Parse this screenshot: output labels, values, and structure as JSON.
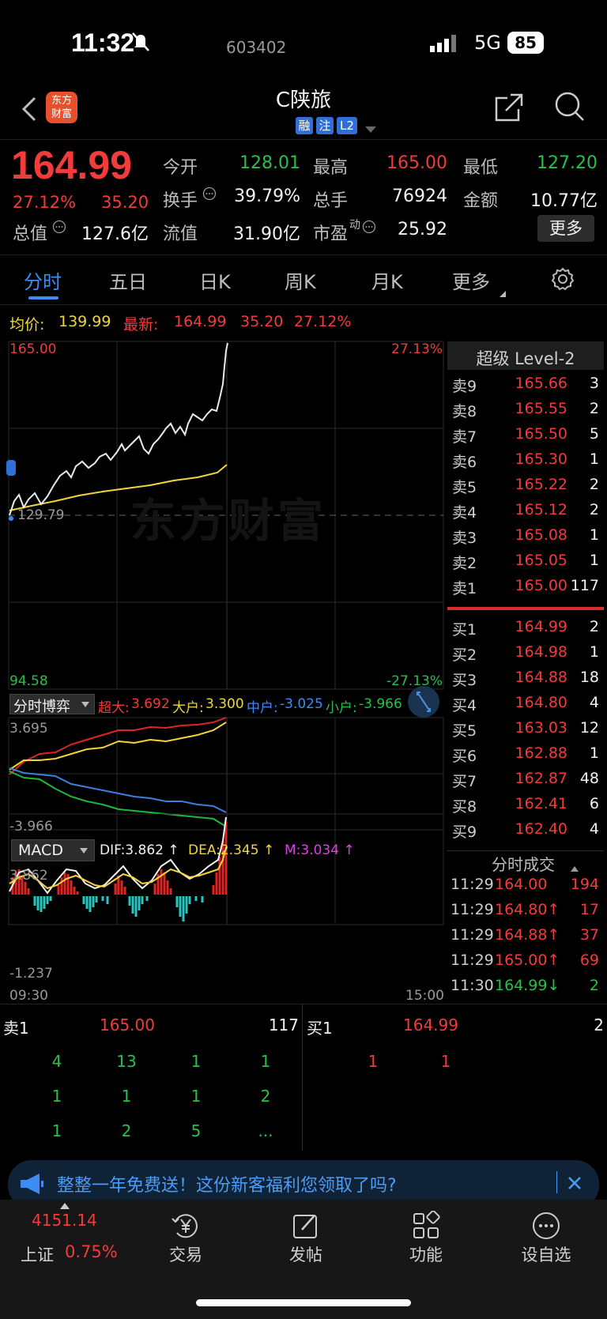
{
  "status_bar": {
    "time": "11:32",
    "network": "5G",
    "battery": "85"
  },
  "header": {
    "logo_line1": "东方",
    "logo_line2": "财富",
    "stock_name": "C陕旅",
    "stock_code": "603402",
    "tags": [
      "融",
      "注",
      "L2"
    ]
  },
  "quote": {
    "price": "164.99",
    "change_pct": "27.12%",
    "change": "35.20",
    "open_label": "今开",
    "open": "128.01",
    "high_label": "最高",
    "high": "165.00",
    "low_label": "最低",
    "low": "127.20",
    "turnover_label": "换手",
    "turnover": "39.79%",
    "volume_label": "总手",
    "volume": "76924",
    "amount_label": "金额",
    "amount": "10.77亿",
    "mktcap_label": "总值",
    "mktcap": "127.6亿",
    "float_label": "流值",
    "float_cap": "31.90亿",
    "pe_label": "市盈",
    "pe_sup": "动",
    "pe": "25.92",
    "more_button": "更多"
  },
  "tabs": [
    "分时",
    "五日",
    "日K",
    "周K",
    "月K",
    "更多"
  ],
  "intraday": {
    "avg_label": "均价:",
    "avg": "139.99",
    "latest_label": "最新:",
    "latest": "164.99",
    "latest_change": "35.20",
    "latest_pct": "27.12%",
    "y_top": "165.00",
    "y_top_pct": "27.13%",
    "y_mid": "129.79",
    "y_bottom": "94.58",
    "y_bottom_pct": "-27.13%",
    "watermark": "东方财富",
    "t_start": "09:30",
    "t_end": "15:00"
  },
  "game": {
    "title": "分时博弈",
    "super_label": "超大:",
    "super": "3.692",
    "large_label": "大户:",
    "large": "3.300",
    "mid_label": "中户:",
    "mid": "-3.025",
    "small_label": "小户:",
    "small": "-3.966",
    "y_top": "3.695",
    "y_bottom": "-3.966"
  },
  "macd": {
    "title": "MACD",
    "dif": "DIF:3.862 ↑",
    "dea": "DEA:2.345 ↑",
    "m": "M:3.034 ↑",
    "y_top": "3.862",
    "y_bottom": "-1.237"
  },
  "orderbook": {
    "title": "超级 Level-2",
    "asks": [
      {
        "label": "卖9",
        "price": "165.66",
        "qty": "3"
      },
      {
        "label": "卖8",
        "price": "165.55",
        "qty": "2"
      },
      {
        "label": "卖7",
        "price": "165.50",
        "qty": "5"
      },
      {
        "label": "卖6",
        "price": "165.30",
        "qty": "1"
      },
      {
        "label": "卖5",
        "price": "165.22",
        "qty": "2"
      },
      {
        "label": "卖4",
        "price": "165.12",
        "qty": "2"
      },
      {
        "label": "卖3",
        "price": "165.08",
        "qty": "1"
      },
      {
        "label": "卖2",
        "price": "165.05",
        "qty": "1"
      },
      {
        "label": "卖1",
        "price": "165.00",
        "qty": "117"
      }
    ],
    "bids": [
      {
        "label": "买1",
        "price": "164.99",
        "qty": "2"
      },
      {
        "label": "买2",
        "price": "164.98",
        "qty": "1"
      },
      {
        "label": "买3",
        "price": "164.88",
        "qty": "18"
      },
      {
        "label": "买4",
        "price": "164.80",
        "qty": "4"
      },
      {
        "label": "买5",
        "price": "163.03",
        "qty": "12"
      },
      {
        "label": "买6",
        "price": "162.88",
        "qty": "1"
      },
      {
        "label": "买7",
        "price": "162.87",
        "qty": "48"
      },
      {
        "label": "买8",
        "price": "162.41",
        "qty": "6"
      },
      {
        "label": "买9",
        "price": "162.40",
        "qty": "4"
      }
    ],
    "trades_title": "分时成交",
    "trades": [
      {
        "time": "11:29",
        "price": "164.00",
        "qty": "194",
        "dir": "",
        "color": "red"
      },
      {
        "time": "11:29",
        "price": "164.80↑",
        "qty": "17",
        "dir": "",
        "color": "red"
      },
      {
        "time": "11:29",
        "price": "164.88↑",
        "qty": "37",
        "dir": "",
        "color": "red"
      },
      {
        "time": "11:29",
        "price": "165.00↑",
        "qty": "69",
        "dir": "",
        "color": "red"
      },
      {
        "time": "11:30",
        "price": "164.99↓",
        "qty": "2",
        "dir": "",
        "color": "green"
      }
    ]
  },
  "queue": {
    "sell_label": "卖1",
    "sell_price": "165.00",
    "sell_qty": "117",
    "buy_label": "买1",
    "buy_price": "164.99",
    "buy_qty": "2",
    "sell_orders": [
      "4",
      "13",
      "1",
      "1",
      "1",
      "1",
      "1",
      "2",
      "1",
      "2",
      "5",
      "..."
    ],
    "buy_orders": [
      "1",
      "1"
    ]
  },
  "banner": {
    "text": "整整一年免费送！这份新客福利您领取了吗?"
  },
  "tabbar": {
    "index_value": "4151.14",
    "index_name": "上证",
    "index_pct": "0.75%",
    "items": [
      "交易",
      "发帖",
      "功能",
      "设自选"
    ]
  }
}
